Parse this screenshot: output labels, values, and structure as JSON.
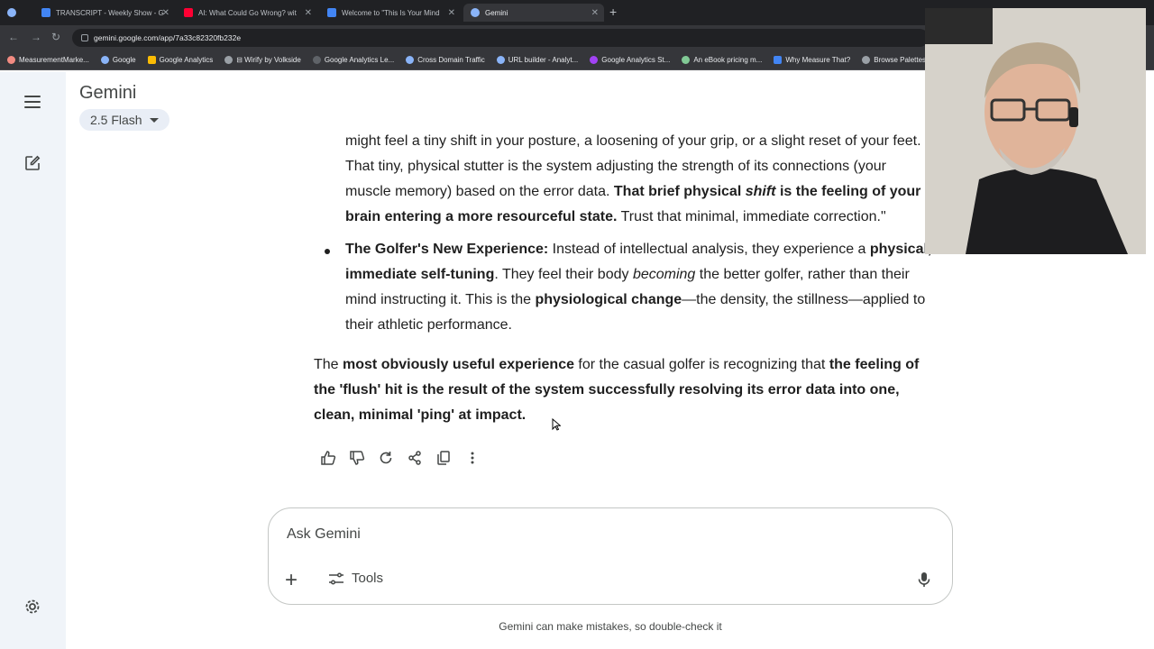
{
  "browser": {
    "tabs": [
      {
        "label": "TRANSCRIPT - Weekly Show - G",
        "color": "#4285f4"
      },
      {
        "label": "AI: What Could Go Wrong? wit",
        "color": "#ff0033"
      },
      {
        "label": "Welcome to \"This Is Your Mind",
        "color": "#4285f4"
      },
      {
        "label": "Gemini",
        "color": "#8ab4f8"
      }
    ],
    "url": "gemini.google.com/app/7a33c82320fb232e",
    "bookmarks": [
      "MeasurementMarke...",
      "Google",
      "Google Analytics",
      "⊟ Wirify by Volkside",
      "Google Analytics Le...",
      "Cross Domain Traffic",
      "URL builder - Analyt...",
      "Google Analytics St...",
      "An eBook pricing m...",
      "Why Measure That?",
      "Browse Palettes ::"
    ]
  },
  "app": {
    "title": "Gemini",
    "model": "2.5 Flash"
  },
  "response": {
    "l1": "might feel a tiny shift in your posture, a loosening of your grip, or a slight reset of your feet.",
    "l2": "That tiny, physical stutter is the system adjusting the strength of its connections (your",
    "l3a": "muscle memory) based on the error data. ",
    "l3b": "That brief physical ",
    "l3c": "shift",
    "l3d": " is the feeling of your",
    "l4a": "brain entering a more resourceful state.",
    "l4b": " Trust that minimal, immediate correction.\"",
    "b2a": "The Golfer's New Experience:",
    "b2b": " Instead of intellectual analysis, they experience a ",
    "b2c": "physical,",
    "b3a": "immediate self-tuning",
    "b3b": ". They feel their body ",
    "b3c": "becoming",
    "b3d": " the better golfer, rather than their",
    "b4a": "mind instructing it. This is the ",
    "b4b": "physiological change",
    "b4c": "—the density, the stillness—applied to",
    "b5": "their athletic performance.",
    "p1a": "The ",
    "p1b": "most obviously useful experience",
    "p1c": " for the casual golfer is recognizing that ",
    "p1d": "the feeling of",
    "p2": "the 'flush' hit is the result of the system successfully resolving its error data into one,",
    "p3": "clean, minimal 'ping' at impact."
  },
  "input": {
    "placeholder": "Ask Gemini",
    "tools_label": "Tools"
  },
  "disclaimer": "Gemini can make mistakes, so double-check it"
}
